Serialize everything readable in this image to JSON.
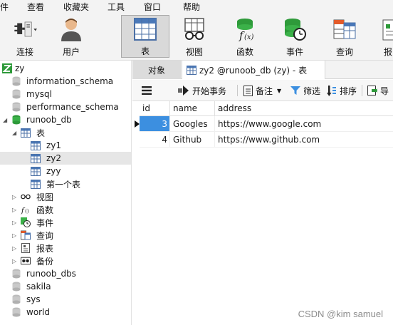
{
  "menu": [
    "件",
    "查看",
    "收藏夹",
    "工具",
    "窗口",
    "帮助"
  ],
  "toolbar": {
    "connect": "连接",
    "user": "用户",
    "table": "表",
    "view": "视图",
    "function": "函数",
    "event": "事件",
    "query": "查询",
    "report": "报"
  },
  "tree": {
    "root": "zy",
    "dbs": [
      "information_schema",
      "mysql",
      "performance_schema",
      "runoob_db"
    ],
    "tables_group": "表",
    "tables": [
      "zy1",
      "zy2",
      "zyy",
      "第一个表"
    ],
    "groups": [
      "视图",
      "函数",
      "事件",
      "查询",
      "报表",
      "备份"
    ],
    "other_dbs": [
      "runoob_dbs",
      "sakila",
      "sys",
      "world"
    ]
  },
  "tabs": {
    "objects": "对象",
    "current": "zy2 @runoob_db (zy) - 表"
  },
  "subbar": {
    "begin_tx": "开始事务",
    "note": "备注",
    "filter": "筛选",
    "sort": "排序",
    "import": "导"
  },
  "grid": {
    "columns": [
      "id",
      "name",
      "address"
    ],
    "rows": [
      {
        "id": "3",
        "name": "Googles",
        "address": "https://www.google.com"
      },
      {
        "id": "4",
        "name": "Github",
        "address": "https://www.github.com"
      }
    ]
  },
  "watermark": "CSDN @kim samuel",
  "colors": {
    "accent": "#3c8fe0",
    "db_green": "#2e9a3a",
    "table_blue": "#4a78b8"
  }
}
